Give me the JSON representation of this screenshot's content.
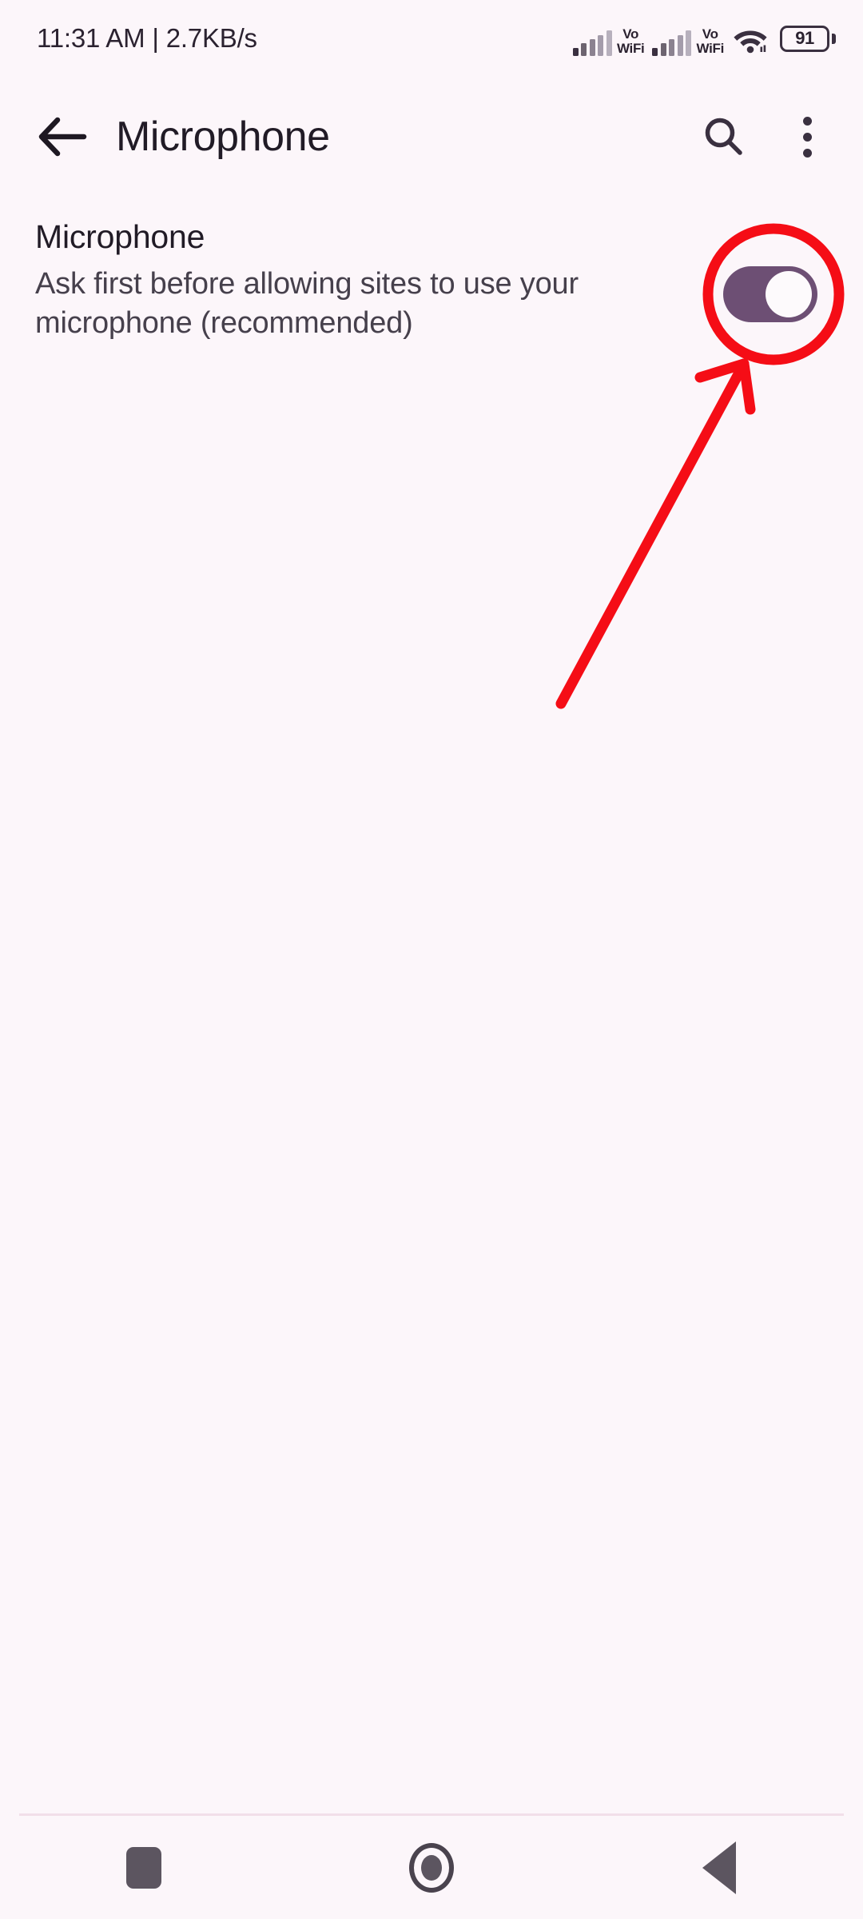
{
  "status_bar": {
    "time_and_speed": "11:31 AM | 2.7KB/s",
    "signal1_label": "Vo",
    "signal1_label2": "WiFi",
    "signal2_label": "Vo",
    "signal2_label2": "WiFi",
    "wifi_icon": "wifi-icon",
    "battery_level": "91"
  },
  "app_bar": {
    "back_icon": "back-arrow-icon",
    "title": "Microphone",
    "search_icon": "search-icon",
    "overflow_icon": "overflow-menu-icon"
  },
  "content": {
    "setting_title": "Microphone",
    "setting_description": "Ask first before allowing sites to use your microphone (recommended)",
    "toggle_state": "on",
    "toggle_color": "#6d4f74",
    "toggle_knob_color": "#fdfafc"
  },
  "annotations": {
    "highlight_color": "#f50d16",
    "circle_label": "highlight-circle-around-toggle",
    "arrow_label": "pointer-arrow-to-toggle"
  },
  "nav_bar": {
    "recents_label": "recents-button",
    "home_label": "home-button",
    "back_label": "back-button"
  },
  "theme": {
    "background": "#fcf6fa",
    "text_primary": "#211b26",
    "text_secondary": "#46404c"
  }
}
